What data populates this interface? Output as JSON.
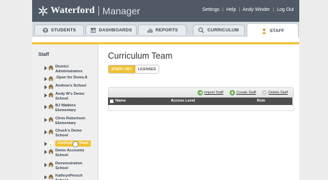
{
  "header": {
    "brand": "Waterford",
    "product": "Manager",
    "nav": [
      "Settings",
      "Help",
      "Andy Winder",
      "Log Out"
    ]
  },
  "tabs": [
    {
      "label": "STUDENTS",
      "icon": "students-icon"
    },
    {
      "label": "DASHBOARDS",
      "icon": "dashboards-icon"
    },
    {
      "label": "REPORTS",
      "icon": "reports-icon"
    },
    {
      "label": "CURRICULUM",
      "icon": "curriculum-icon"
    },
    {
      "label": "STAFF",
      "icon": "staff-icon",
      "active": true
    }
  ],
  "sidebar": {
    "title": "Staff",
    "items": [
      {
        "label": "District\nAdministrators"
      },
      {
        "label": ".Open for Demo.8"
      },
      {
        "label": "Andrew's School"
      },
      {
        "label": "Andy W's Demo\nSchool"
      },
      {
        "label": "BJ Watkins\nElementary"
      },
      {
        "label": "Chris Robertson\nElementary"
      },
      {
        "label": "Chuck's Demo\nSchool"
      },
      {
        "label": "Curriculum Team",
        "selected": true
      },
      {
        "label": "Demo Accounts\nSchool"
      },
      {
        "label": "Demonstration\nSchool"
      },
      {
        "label": "KathrynPersch\nSchool"
      }
    ]
  },
  "main": {
    "title": "Curriculum Team",
    "segments": [
      {
        "label": "STAFF LIST",
        "active": true
      },
      {
        "label": "LICENSES",
        "active": false
      }
    ],
    "toolbar": {
      "import": "Import Staff",
      "create": "Create Staff",
      "delete": "Delete Staff"
    },
    "table": {
      "columns": [
        "Name",
        "Access Level",
        "Role"
      ]
    }
  },
  "colors": {
    "header": "#4f5a66",
    "accent": "#f1c232",
    "import_icon": "#6aa84f",
    "create_icon": "#6aa84f",
    "delete_icon": "#cfcfcf"
  }
}
